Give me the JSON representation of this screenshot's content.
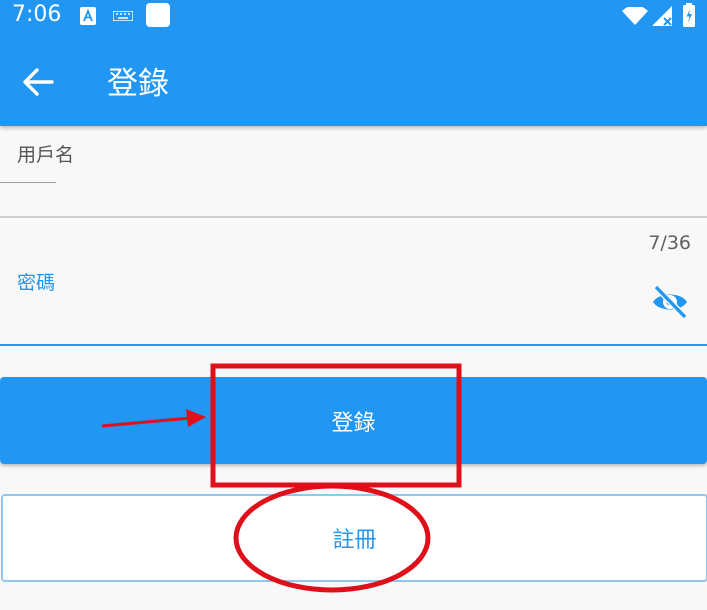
{
  "status_bar": {
    "time": "7:06",
    "left_icons": [
      "a-notification-icon",
      "keyboard-icon",
      "blank-square-icon"
    ],
    "right_icons": [
      "wifi-icon",
      "cell-signal-icon",
      "battery-icon"
    ]
  },
  "toolbar": {
    "back_icon": "arrow-left-icon",
    "title": "登錄"
  },
  "form": {
    "username": {
      "label": "用戶名",
      "value": ""
    },
    "password": {
      "label": "密碼",
      "counter": "7/36",
      "visibility_icon": "eye-off-icon"
    }
  },
  "buttons": {
    "login": "登錄",
    "register": "註冊"
  },
  "annotations": {
    "color": "#e0101a",
    "shapes": [
      "arrow",
      "rectangle",
      "ellipse"
    ]
  }
}
